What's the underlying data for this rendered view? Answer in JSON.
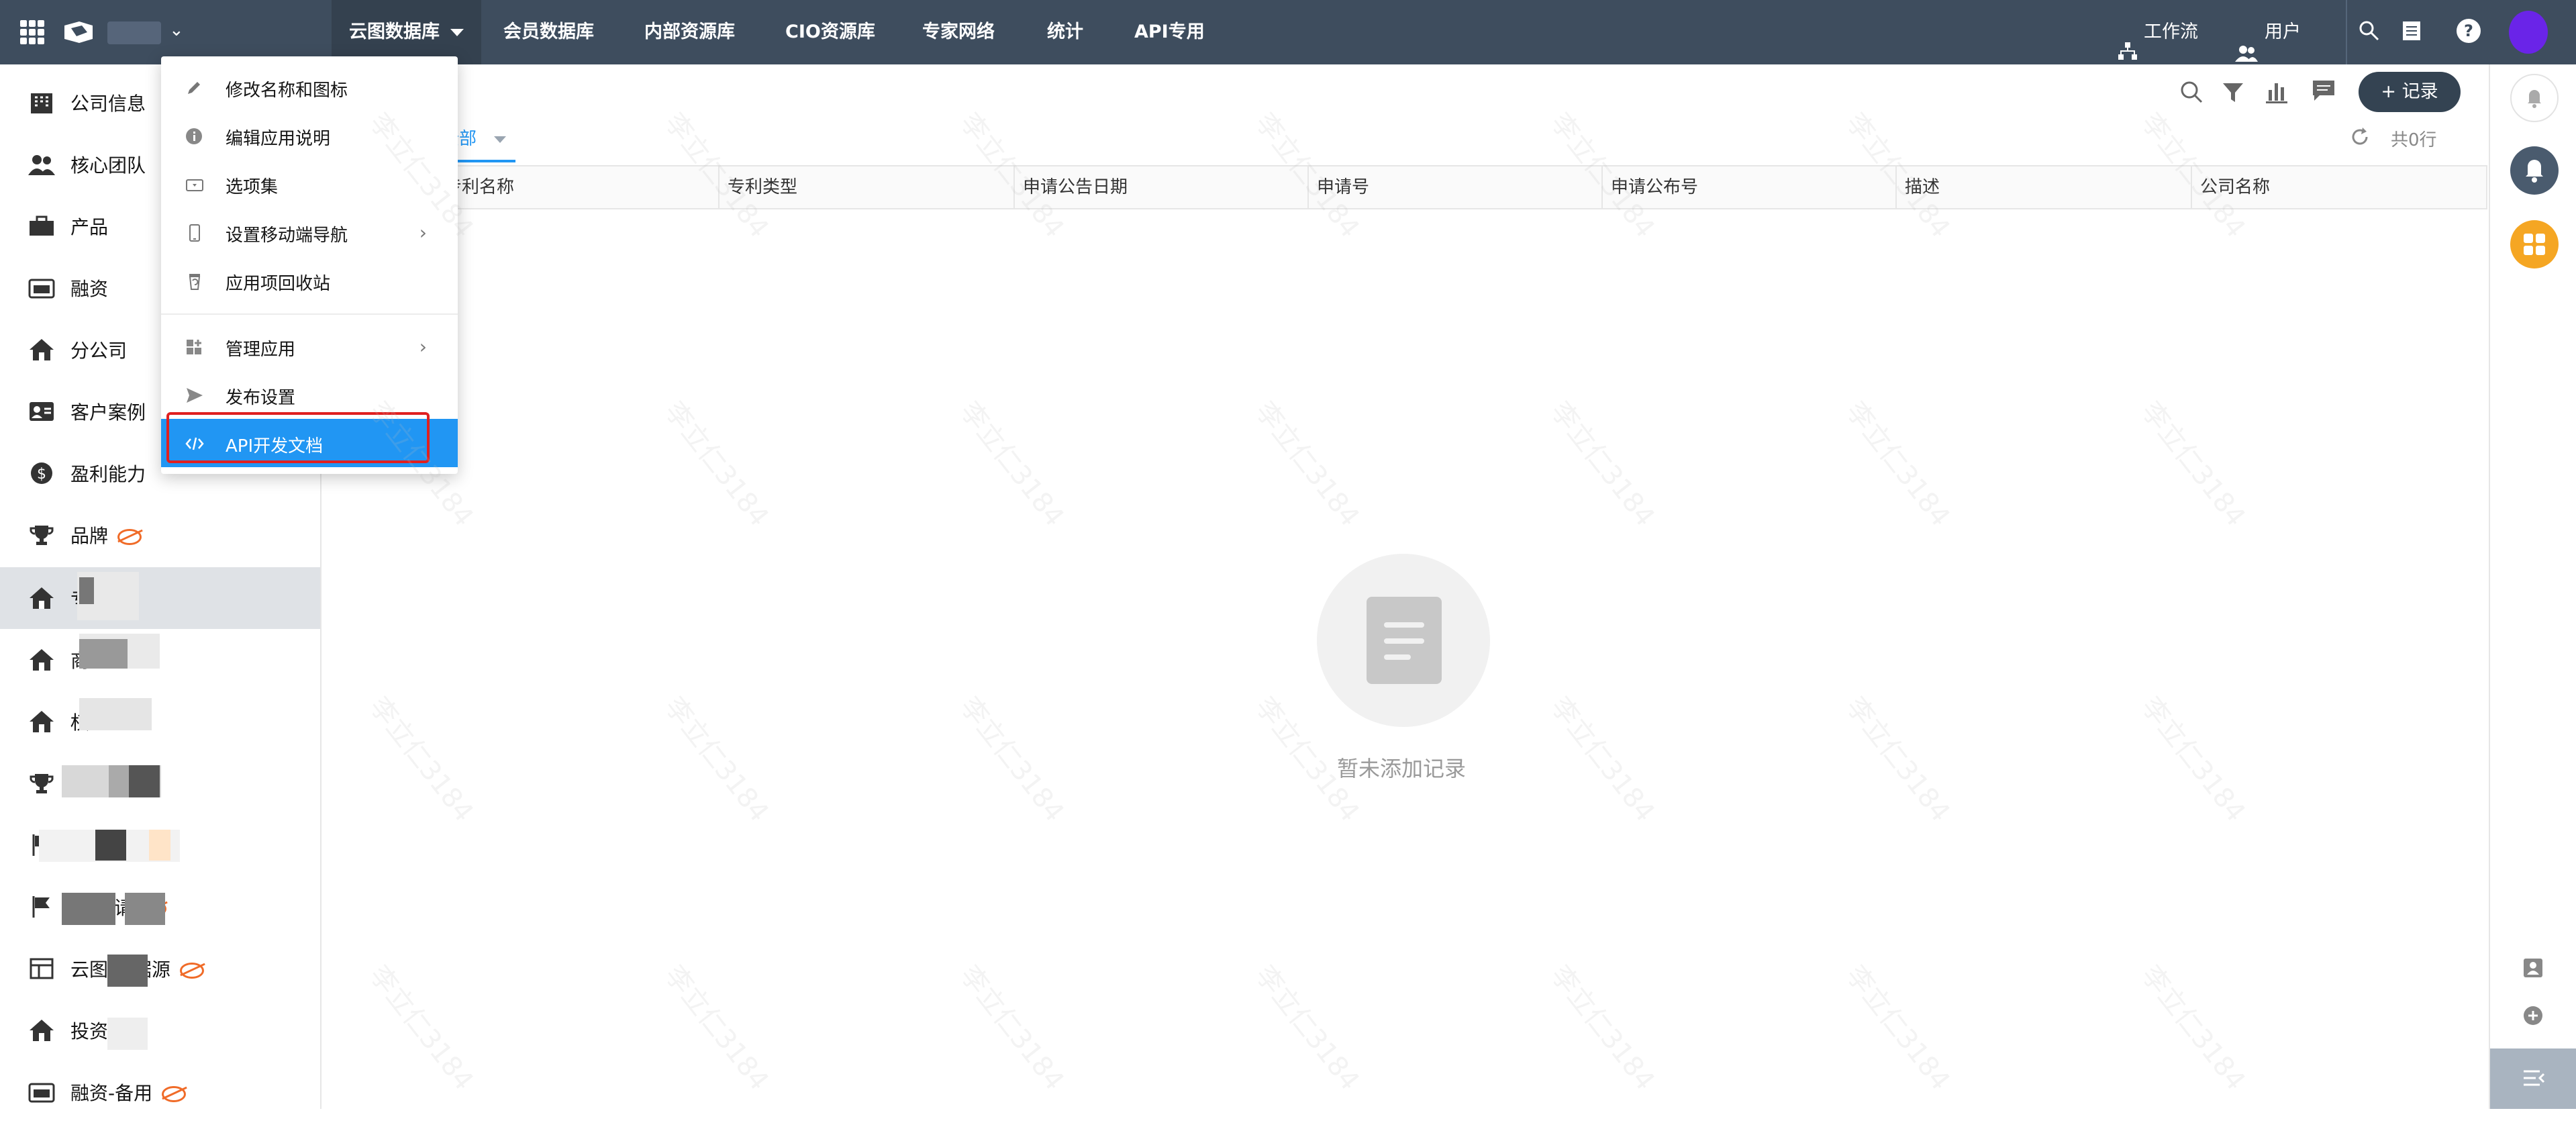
{
  "topbar": {
    "app_name_placeholder": "",
    "nav": [
      "云图数据库",
      "会员数据库",
      "内部资源库",
      "CIO资源库",
      "专家网络",
      "统计",
      "API专用"
    ],
    "workflow_label": "工作流",
    "users_label": "用户"
  },
  "sidebar": {
    "items": [
      {
        "label": "公司信息",
        "icon": "building-icon",
        "hidden": false
      },
      {
        "label": "核心团队",
        "icon": "team-icon",
        "hidden": false
      },
      {
        "label": "产品",
        "icon": "briefcase-icon",
        "hidden": false
      },
      {
        "label": "融资",
        "icon": "money-icon",
        "hidden": false
      },
      {
        "label": "分公司",
        "icon": "home-icon",
        "hidden": false
      },
      {
        "label": "客户案例",
        "icon": "contact-card-icon",
        "hidden": false
      },
      {
        "label": "盈利能力",
        "icon": "dollar-icon",
        "hidden": false
      },
      {
        "label": "品牌",
        "icon": "trophy-icon",
        "hidden": true
      },
      {
        "label": "专",
        "icon": "home-icon",
        "hidden": false
      },
      {
        "label": "商",
        "icon": "home-icon",
        "hidden": false
      },
      {
        "label": "权",
        "icon": "home-icon",
        "hidden": false
      },
      {
        "label": "",
        "icon": "trophy-icon",
        "hidden": false
      },
      {
        "label": "",
        "icon": "flag-icon",
        "hidden": true
      },
      {
        "label": "信息 请",
        "icon": "flag-icon",
        "hidden": true
      },
      {
        "label": "云图 数据源",
        "icon": "table-icon",
        "hidden": true
      },
      {
        "label": "投资",
        "icon": "home-icon",
        "hidden": true
      },
      {
        "label": "融资-备用",
        "icon": "money-icon",
        "hidden": true
      }
    ]
  },
  "menu": {
    "items": [
      {
        "label": "修改名称和图标",
        "icon": "pencil-icon",
        "submenu": false
      },
      {
        "label": "编辑应用说明",
        "icon": "info-icon",
        "submenu": false
      },
      {
        "label": "选项集",
        "icon": "option-set-icon",
        "submenu": false
      },
      {
        "label": "设置移动端导航",
        "icon": "mobile-icon",
        "submenu": true
      },
      {
        "label": "应用项回收站",
        "icon": "trash-icon",
        "submenu": false
      },
      {
        "label": "管理应用",
        "icon": "grid-manage-icon",
        "submenu": true
      },
      {
        "label": "发布设置",
        "icon": "send-icon",
        "submenu": false
      },
      {
        "label": "API开发文档",
        "icon": "code-icon",
        "submenu": false
      }
    ],
    "highlight_color": "#2196f3",
    "annotation_color": "#e02020"
  },
  "main": {
    "view_tab": "全部",
    "add_record_label": "+ 记录",
    "row_count": "共0行",
    "columns": [
      "专利名称",
      "专利类型",
      "申请公告日期",
      "申请号",
      "申请公布号",
      "描述",
      "公司名称"
    ],
    "empty_text": "暂未添加记录",
    "watermark_text": "李立仁3184"
  },
  "colors": {
    "topbar_bg": "#3e4d5e",
    "accent_blue": "#2196f3",
    "add_button_bg": "#344352",
    "orange": "#f5a623"
  }
}
